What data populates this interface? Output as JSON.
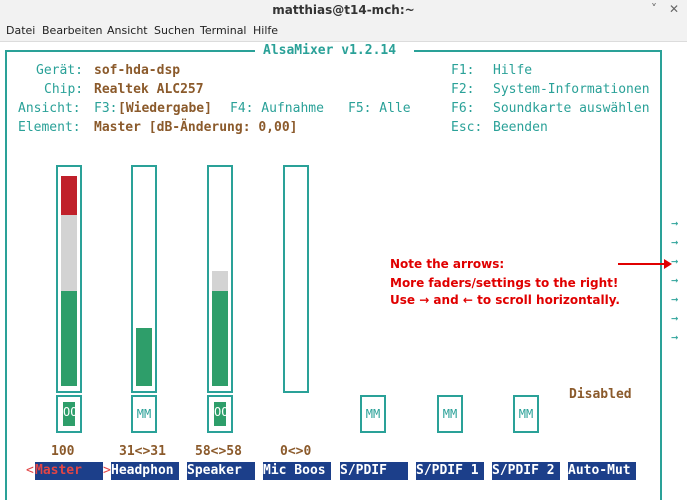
{
  "window": {
    "title": "matthias@t14-mch:~",
    "min_icon": "minimize-icon",
    "close_icon": "close-icon",
    "min_glyph": "˅",
    "close_glyph": "✕"
  },
  "menubar": [
    "Datei",
    "Bearbeiten",
    "Ansicht",
    "Suchen",
    "Terminal",
    "Hilfe"
  ],
  "alsamixer": {
    "title": "AlsaMixer v1.2.14",
    "info": {
      "device_label": "Gerät:",
      "device_value": "sof-hda-dsp",
      "chip_label": "Chip:",
      "chip_value": "Realtek ALC257",
      "view_label": "Ansicht:",
      "view_f3": "F3:",
      "view_current": "[Wiedergabe]",
      "view_f4": "F4: Aufnahme",
      "view_f5": "F5: Alle",
      "element_label": "Element:",
      "element_value": "Master [dB-Änderung: 0,00]"
    },
    "keys": [
      {
        "key": "F1:",
        "desc": "Hilfe"
      },
      {
        "key": "F2:",
        "desc": "System-Informationen"
      },
      {
        "key": "F6:",
        "desc": "Soundkarte auswählen"
      },
      {
        "key": "Esc:",
        "desc": "Beenden"
      }
    ],
    "channels": [
      {
        "name": "Master",
        "value": "100",
        "mute": "OO",
        "has_fader": true,
        "level_pct": 100,
        "selected": true
      },
      {
        "name": "Headphon",
        "value": "31<>31",
        "mute": "MM",
        "has_fader": true,
        "level_pct": 31,
        "selected": false
      },
      {
        "name": "Speaker",
        "value": "58<>58",
        "mute": "OO",
        "has_fader": true,
        "level_pct": 58,
        "selected": false
      },
      {
        "name": "Mic Boos",
        "value": "0<>0",
        "mute": "",
        "has_fader": true,
        "level_pct": 0,
        "selected": false
      },
      {
        "name": "S/PDIF",
        "value": "",
        "mute": "MM",
        "has_fader": false,
        "selected": false
      },
      {
        "name": "S/PDIF 1",
        "value": "",
        "mute": "MM",
        "has_fader": false,
        "selected": false
      },
      {
        "name": "S/PDIF 2",
        "value": "",
        "mute": "MM",
        "has_fader": false,
        "selected": false
      },
      {
        "name": "Auto-Mut",
        "value": "",
        "mute": "",
        "has_fader": false,
        "selected": false
      }
    ],
    "auto_mute_state": "Disabled",
    "selection_left": "<",
    "selection_right": ">",
    "scroll_arrows": [
      "→",
      "→",
      "→",
      "→",
      "→",
      "→",
      "→"
    ]
  },
  "annotation": {
    "line1": "Note the arrows:",
    "line2": "More faders/settings to the right!",
    "line3": "Use → and ← to scroll horizontally."
  },
  "colors": {
    "accent": "#2aa198",
    "label": "#8b5a2b",
    "red": "#c0202a",
    "green": "#2e9e6a",
    "gray": "#d3d3d3",
    "selbg": "#1c3f8a",
    "note": "#e00000"
  }
}
